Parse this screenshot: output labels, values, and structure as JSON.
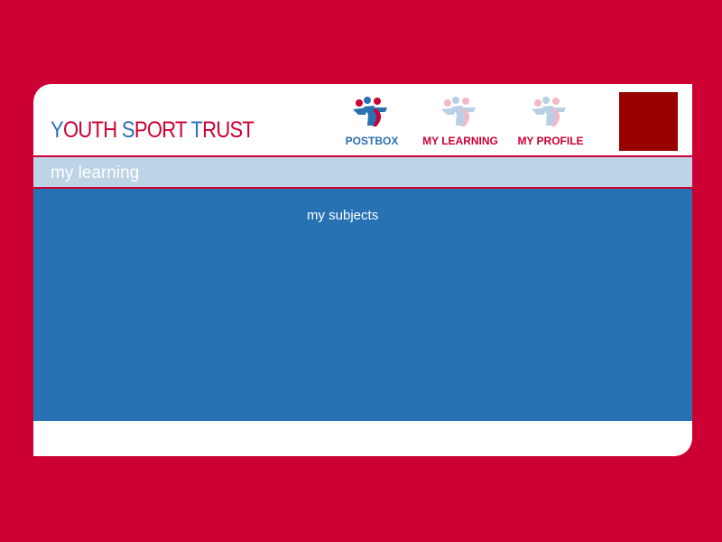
{
  "header": {
    "logo": {
      "word1_initial": "Y",
      "word1_rest": "OUTH",
      "word2_initial": "S",
      "word2_rest": "PORT",
      "word3_initial": "T",
      "word3_rest": "RUST"
    },
    "nav": [
      {
        "label": "POSTBOX",
        "icon": "people-group-icon",
        "state": "active"
      },
      {
        "label": "MY LEARNING",
        "icon": "people-group-icon",
        "state": "faded"
      },
      {
        "label": "MY PROFILE",
        "icon": "people-group-icon",
        "state": "faded"
      }
    ]
  },
  "section": {
    "title": "my learning"
  },
  "content": {
    "subjects_link": "my subjects"
  },
  "colors": {
    "background": "#cc0033",
    "brand_red": "#cc0033",
    "brand_blue": "#2a6fb0",
    "section_bar": "#bdd3e6",
    "content_panel": "#2872b3",
    "avatar_box": "#990000"
  }
}
